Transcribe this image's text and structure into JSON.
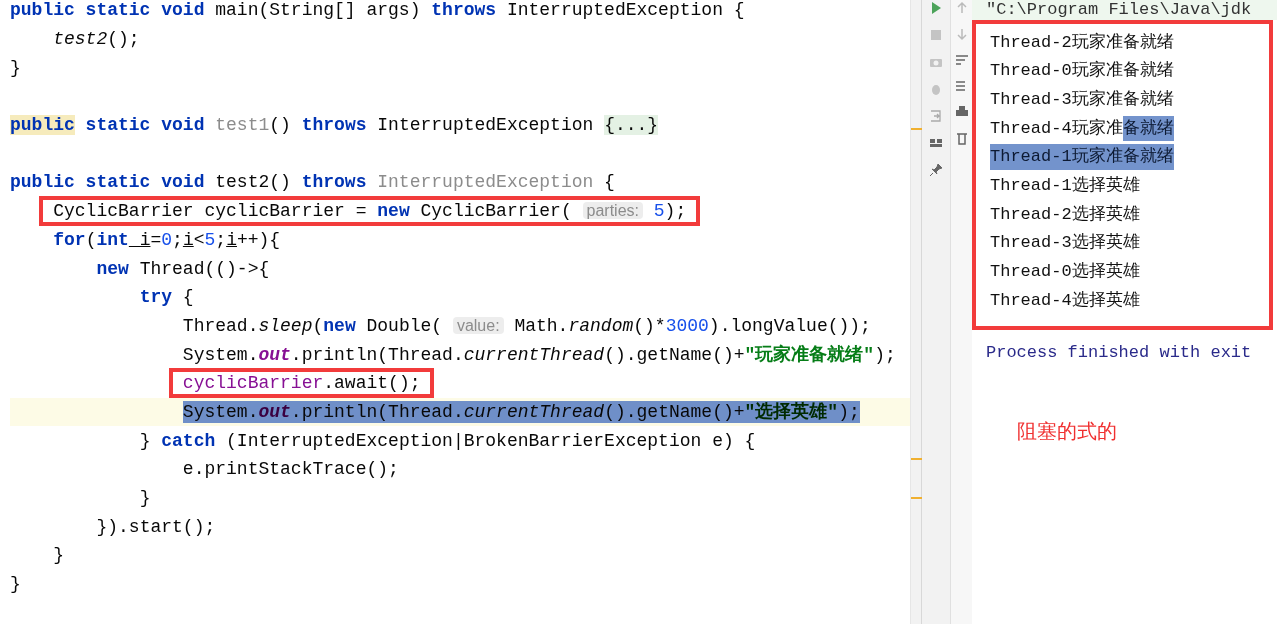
{
  "editor": {
    "lines": [
      {
        "spans": [
          {
            "kind": "kw",
            "text": "public static void"
          },
          {
            "kind": "plain",
            "text": " main(String[] args) "
          },
          {
            "kind": "kw",
            "text": "throws"
          },
          {
            "kind": "plain",
            "text": " InterruptedException {"
          }
        ]
      },
      {
        "spans": [
          {
            "kind": "italic",
            "text": "    test2"
          },
          {
            "kind": "plain",
            "text": "();"
          }
        ]
      },
      {
        "spans": [
          {
            "kind": "plain",
            "text": "}"
          }
        ]
      },
      {
        "kind": "blank"
      },
      {
        "spans": [
          {
            "kind": "kwmark",
            "text": "public"
          },
          {
            "kind": "kw",
            "text": " static void "
          },
          {
            "kind": "dim",
            "text": "test1"
          },
          {
            "kind": "plain",
            "text": "() "
          },
          {
            "kind": "kw",
            "text": "throws"
          },
          {
            "kind": "plain",
            "text": " InterruptedException "
          },
          {
            "kind": "fold",
            "text": "{...}"
          }
        ]
      },
      {
        "kind": "blank"
      },
      {
        "spans": [
          {
            "kind": "kw",
            "text": "public static void"
          },
          {
            "kind": "plain",
            "text": " test2() "
          },
          {
            "kind": "kw",
            "text": "throws"
          },
          {
            "kind": "dim",
            "text": " InterruptedException"
          },
          {
            "kind": "plain",
            "text": " {"
          }
        ]
      },
      {
        "boxed": true,
        "spans": [
          {
            "kind": "plain",
            "text": "    CyclicBarrier cyclicBarrier = "
          },
          {
            "kind": "kw",
            "text": "new"
          },
          {
            "kind": "plain",
            "text": " CyclicBarrier( "
          },
          {
            "kind": "hint",
            "text": "parties:"
          },
          {
            "kind": "num",
            "text": " 5"
          },
          {
            "kind": "plain",
            "text": ");"
          }
        ]
      },
      {
        "spans": [
          {
            "kind": "kw",
            "text": "    for"
          },
          {
            "kind": "plain",
            "text": "("
          },
          {
            "kind": "kw",
            "text": "int"
          },
          {
            "kind": "var",
            "text": " i"
          },
          {
            "kind": "plain",
            "text": "="
          },
          {
            "kind": "num",
            "text": "0"
          },
          {
            "kind": "plain",
            "text": ";"
          },
          {
            "kind": "var",
            "text": "i"
          },
          {
            "kind": "plain",
            "text": "<"
          },
          {
            "kind": "num",
            "text": "5"
          },
          {
            "kind": "plain",
            "text": ";"
          },
          {
            "kind": "var",
            "text": "i"
          },
          {
            "kind": "plain",
            "text": "++){"
          }
        ]
      },
      {
        "spans": [
          {
            "kind": "kw",
            "text": "        new"
          },
          {
            "kind": "plain",
            "text": " Thread(()->{"
          }
        ]
      },
      {
        "spans": [
          {
            "kind": "kw",
            "text": "            try"
          },
          {
            "kind": "plain",
            "text": " {"
          }
        ]
      },
      {
        "spans": [
          {
            "kind": "plain",
            "text": "                Thread."
          },
          {
            "kind": "italic",
            "text": "sleep"
          },
          {
            "kind": "plain",
            "text": "("
          },
          {
            "kind": "kw",
            "text": "new"
          },
          {
            "kind": "plain",
            "text": " Double( "
          },
          {
            "kind": "hint",
            "text": "value:"
          },
          {
            "kind": "plain",
            "text": " Math."
          },
          {
            "kind": "italic",
            "text": "random"
          },
          {
            "kind": "plain",
            "text": "()*"
          },
          {
            "kind": "num",
            "text": "3000"
          },
          {
            "kind": "plain",
            "text": ").longValue());"
          }
        ]
      },
      {
        "spans": [
          {
            "kind": "plain",
            "text": "                System."
          },
          {
            "kind": "static",
            "text": "out"
          },
          {
            "kind": "plain",
            "text": ".println(Thread."
          },
          {
            "kind": "italic",
            "text": "currentThread"
          },
          {
            "kind": "plain",
            "text": "().getName()+"
          },
          {
            "kind": "string",
            "text": "\"玩家准备就绪\""
          },
          {
            "kind": "plain",
            "text": ");"
          }
        ]
      },
      {
        "boxed": true,
        "spans": [
          {
            "kind": "field",
            "text": "                cyclicBarrier"
          },
          {
            "kind": "plain",
            "text": ".await();"
          }
        ]
      },
      {
        "selected": true,
        "current": true,
        "spans": [
          {
            "kind": "plain",
            "text": "                System."
          },
          {
            "kind": "static",
            "text": "out"
          },
          {
            "kind": "plain",
            "text": ".println(Thread."
          },
          {
            "kind": "italic",
            "text": "currentThread"
          },
          {
            "kind": "plain",
            "text": "().getName()+"
          },
          {
            "kind": "string",
            "text": "\"选择英雄\""
          },
          {
            "kind": "plain",
            "text": ");"
          }
        ]
      },
      {
        "spans": [
          {
            "kind": "plain",
            "text": "            } "
          },
          {
            "kind": "kw",
            "text": "catch"
          },
          {
            "kind": "plain",
            "text": " (InterruptedException|BrokenBarrierException e) {"
          }
        ]
      },
      {
        "spans": [
          {
            "kind": "plain",
            "text": "                e.printStackTrace();"
          }
        ]
      },
      {
        "spans": [
          {
            "kind": "plain",
            "text": "            }"
          }
        ]
      },
      {
        "spans": [
          {
            "kind": "plain",
            "text": "        }).start();"
          }
        ]
      },
      {
        "spans": [
          {
            "kind": "plain",
            "text": "    }"
          }
        ]
      },
      {
        "spans": [
          {
            "kind": "plain",
            "text": "}"
          }
        ]
      }
    ]
  },
  "console": {
    "command": "\"C:\\Program Files\\Java\\jdk",
    "lines": [
      {
        "segments": [
          {
            "text": "Thread-2玩家准备就绪",
            "selected": false
          }
        ]
      },
      {
        "segments": [
          {
            "text": "Thread-0玩家准备就绪",
            "selected": false
          }
        ]
      },
      {
        "segments": [
          {
            "text": "Thread-3玩家准备就绪",
            "selected": false
          }
        ]
      },
      {
        "segments": [
          {
            "text": "Thread-4玩家准",
            "selected": false
          },
          {
            "text": "备就绪",
            "selected": true
          }
        ]
      },
      {
        "segments": [
          {
            "text": "Thread-1玩家准备就绪",
            "selected": true
          }
        ]
      },
      {
        "segments": [
          {
            "text": "Thread-1选择英雄",
            "selected": false
          }
        ]
      },
      {
        "segments": [
          {
            "text": "Thread-2选择英雄",
            "selected": false
          }
        ]
      },
      {
        "segments": [
          {
            "text": "Thread-3选择英雄",
            "selected": false
          }
        ]
      },
      {
        "segments": [
          {
            "text": "Thread-0选择英雄",
            "selected": false
          }
        ]
      },
      {
        "segments": [
          {
            "text": "Thread-4选择英雄",
            "selected": false
          }
        ]
      }
    ],
    "exit_message": "Process finished with exit",
    "annotation": "阻塞的式的"
  }
}
